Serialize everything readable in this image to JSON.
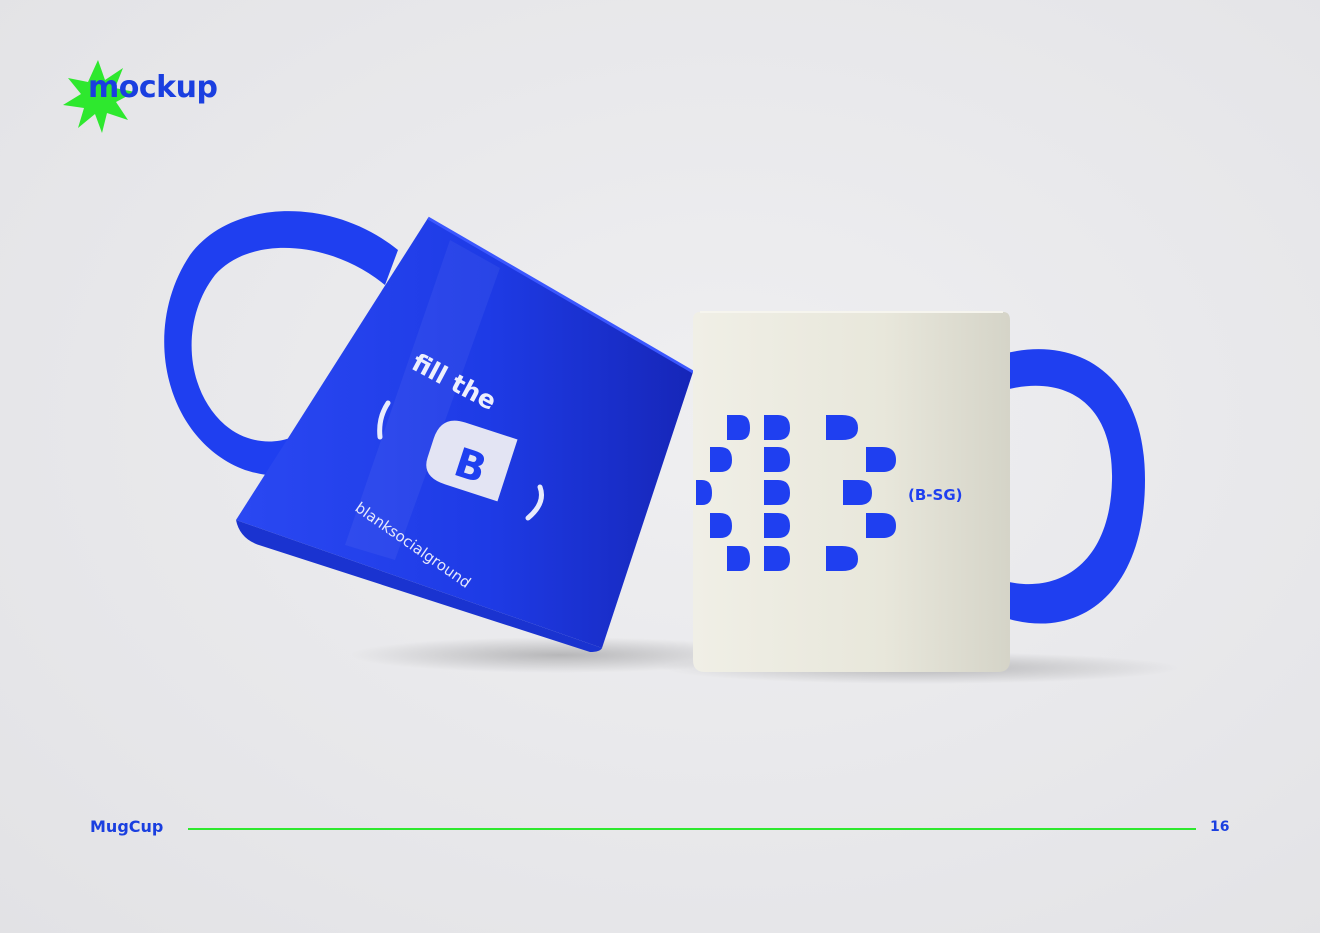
{
  "header": {
    "title": "mockup"
  },
  "blue_mug": {
    "slogan": "fill the",
    "brand_letter": "B",
    "website": "blanksocialground"
  },
  "white_mug": {
    "logo_text": "(B-SG)"
  },
  "footer": {
    "section_label": "MugCup",
    "page_number": "16"
  },
  "colors": {
    "brand_blue": "#1a3fe0",
    "accent_green": "#2ee82e",
    "mug_white": "#ecebe0",
    "background": "#e8e8eb"
  }
}
